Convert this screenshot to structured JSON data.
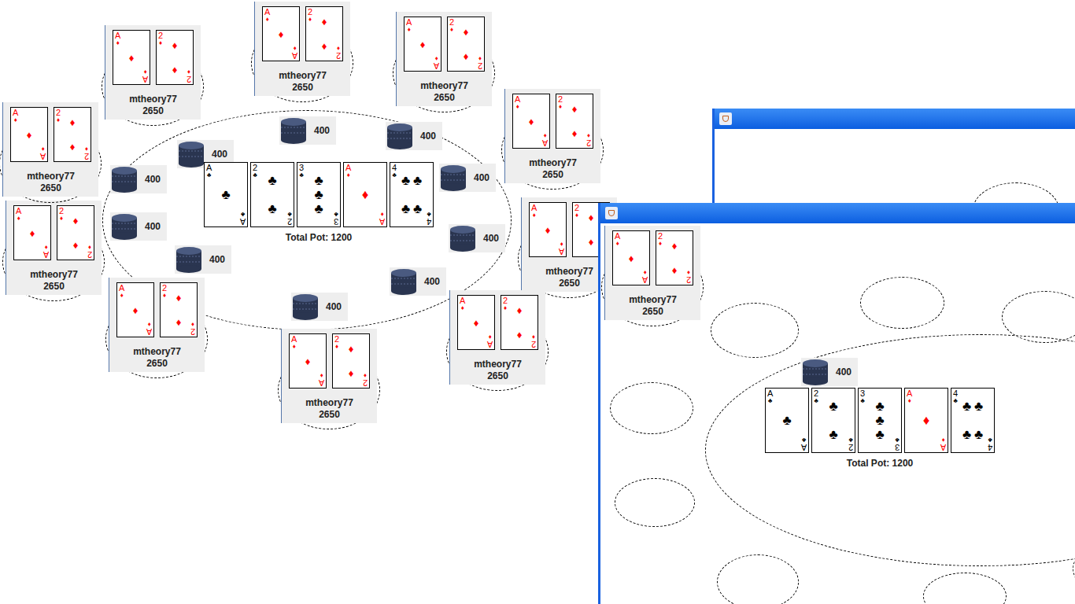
{
  "main_table": {
    "seats": [
      {
        "name": "mtheory77",
        "chips": "2650",
        "cards": [
          {
            "rank": "A",
            "suit": "♦",
            "color": "#ff0000"
          },
          {
            "rank": "2",
            "suit": "♦",
            "color": "#ff0000"
          }
        ]
      },
      {
        "name": "mtheory77",
        "chips": "2650",
        "cards": [
          {
            "rank": "A",
            "suit": "♦",
            "color": "#ff0000"
          },
          {
            "rank": "2",
            "suit": "♦",
            "color": "#ff0000"
          }
        ]
      },
      {
        "name": "mtheory77",
        "chips": "2650",
        "cards": [
          {
            "rank": "A",
            "suit": "♦",
            "color": "#ff0000"
          },
          {
            "rank": "2",
            "suit": "♦",
            "color": "#ff0000"
          }
        ]
      },
      {
        "name": "mtheory77",
        "chips": "2650",
        "cards": [
          {
            "rank": "A",
            "suit": "♦",
            "color": "#ff0000"
          },
          {
            "rank": "2",
            "suit": "♦",
            "color": "#ff0000"
          }
        ]
      },
      {
        "name": "mtheory77",
        "chips": "2650",
        "cards": [
          {
            "rank": "A",
            "suit": "♦",
            "color": "#ff0000"
          },
          {
            "rank": "2",
            "suit": "♦",
            "color": "#ff0000"
          }
        ]
      },
      {
        "name": "mtheory77",
        "chips": "2650",
        "cards": [
          {
            "rank": "A",
            "suit": "♦",
            "color": "#ff0000"
          },
          {
            "rank": "2",
            "suit": "♦",
            "color": "#ff0000"
          }
        ]
      },
      {
        "name": "mtheory77",
        "chips": "2650",
        "cards": [
          {
            "rank": "A",
            "suit": "♦",
            "color": "#ff0000"
          },
          {
            "rank": "2",
            "suit": "♦",
            "color": "#ff0000"
          }
        ]
      },
      {
        "name": "mtheory77",
        "chips": "2650",
        "cards": [
          {
            "rank": "A",
            "suit": "♦",
            "color": "#ff0000"
          },
          {
            "rank": "2",
            "suit": "♦",
            "color": "#ff0000"
          }
        ]
      },
      {
        "name": "mtheory77",
        "chips": "2650",
        "cards": [
          {
            "rank": "A",
            "suit": "♦",
            "color": "#ff0000"
          },
          {
            "rank": "2",
            "suit": "♦",
            "color": "#ff0000"
          }
        ]
      },
      {
        "name": "mtheory77",
        "chips": "2650",
        "cards": [
          {
            "rank": "A",
            "suit": "♦",
            "color": "#ff0000"
          },
          {
            "rank": "2",
            "suit": "♦",
            "color": "#ff0000"
          }
        ]
      }
    ],
    "bets": [
      {
        "amount": "400"
      },
      {
        "amount": "400"
      },
      {
        "amount": "400"
      },
      {
        "amount": "400"
      },
      {
        "amount": "400"
      },
      {
        "amount": "400"
      },
      {
        "amount": "400"
      },
      {
        "amount": "400"
      },
      {
        "amount": "400"
      },
      {
        "amount": "400"
      }
    ],
    "community_cards": [
      {
        "rank": "A",
        "suit": "♣",
        "color": "#000000"
      },
      {
        "rank": "2",
        "suit": "♣",
        "color": "#000000"
      },
      {
        "rank": "3",
        "suit": "♣",
        "color": "#000000"
      },
      {
        "rank": "A",
        "suit": "♦",
        "color": "#ff0000"
      },
      {
        "rank": "4",
        "suit": "♣",
        "color": "#000000"
      }
    ],
    "pot": "Total Pot: 1200"
  },
  "front_window": {
    "seats": [
      {
        "name": "mtheory77",
        "chips": "2650",
        "cards": [
          {
            "rank": "A",
            "suit": "♦",
            "color": "#ff0000"
          },
          {
            "rank": "2",
            "suit": "♦",
            "color": "#ff0000"
          }
        ]
      }
    ],
    "bets": [
      {
        "amount": "400"
      }
    ],
    "community_cards": [
      {
        "rank": "A",
        "suit": "♣",
        "color": "#000000"
      },
      {
        "rank": "2",
        "suit": "♣",
        "color": "#000000"
      },
      {
        "rank": "3",
        "suit": "♣",
        "color": "#000000"
      },
      {
        "rank": "A",
        "suit": "♦",
        "color": "#ff0000"
      },
      {
        "rank": "4",
        "suit": "♣",
        "color": "#000000"
      }
    ],
    "pot": "Total Pot: 1200"
  }
}
